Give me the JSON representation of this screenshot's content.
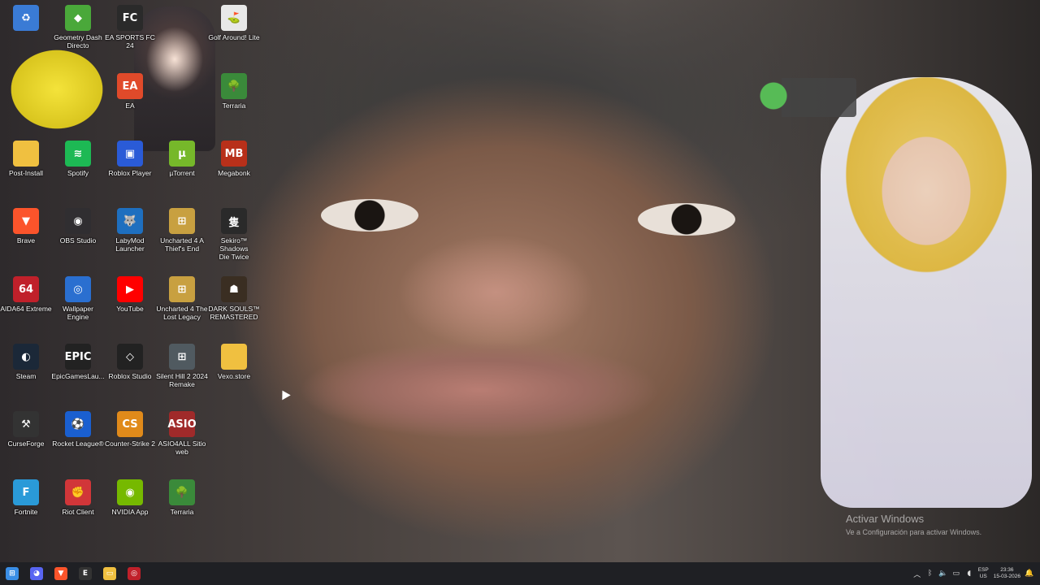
{
  "desktop": {
    "icons": [
      {
        "label": "",
        "icon": "recycle-bin-icon",
        "color": "#3a7bd5",
        "glyph": "♻"
      },
      {
        "label": "Geometry Dash\nDirecto",
        "icon": "geometry-dash-icon",
        "color": "#4aa83a",
        "glyph": "◆"
      },
      {
        "label": "EA SPORTS FC\n24",
        "icon": "ea-sports-fc-icon",
        "color": "#2a2a2a",
        "glyph": "FC"
      },
      {
        "label": "Golf Around! Lite",
        "icon": "golf-around-icon",
        "color": "#e8e8e8",
        "glyph": "⛳"
      },
      {
        "label": "EA",
        "icon": "ea-app-icon",
        "color": "#e04a2a",
        "glyph": "EA"
      },
      {
        "label": "Terraria",
        "icon": "terraria-icon",
        "color": "#3a8a3a",
        "glyph": "🌳"
      },
      {
        "label": "Post-Install",
        "icon": "folder-icon",
        "color": "#f0c040",
        "glyph": ""
      },
      {
        "label": "Spotify",
        "icon": "spotify-icon",
        "color": "#1db954",
        "glyph": "≋"
      },
      {
        "label": "Roblox Player",
        "icon": "roblox-player-icon",
        "color": "#2a5bd7",
        "glyph": "▣"
      },
      {
        "label": "µTorrent",
        "icon": "utorrent-icon",
        "color": "#76b82a",
        "glyph": "µ"
      },
      {
        "label": "Megabonk",
        "icon": "megabonk-icon",
        "color": "#b8301a",
        "glyph": "MB"
      },
      {
        "label": "Brave",
        "icon": "brave-icon",
        "color": "#fb542b",
        "glyph": "▼"
      },
      {
        "label": "OBS Studio",
        "icon": "obs-studio-icon",
        "color": "#302e31",
        "glyph": "◉"
      },
      {
        "label": "LabyMod\nLauncher",
        "icon": "labymod-icon",
        "color": "#1e6fbf",
        "glyph": "🐺"
      },
      {
        "label": "Uncharted 4 A\nThief's End",
        "icon": "uncharted-4-icon",
        "color": "#c8a040",
        "glyph": "⊞"
      },
      {
        "label": "Sekiro™ Shadows\nDie Twice",
        "icon": "sekiro-icon",
        "color": "#2a2a2a",
        "glyph": "隻"
      },
      {
        "label": "AIDA64 Extreme",
        "icon": "aida64-icon",
        "color": "#c0202a",
        "glyph": "64"
      },
      {
        "label": "Wallpaper Engine",
        "icon": "wallpaper-engine-icon",
        "color": "#2a6fd0",
        "glyph": "◎"
      },
      {
        "label": "YouTube",
        "icon": "youtube-icon",
        "color": "#ff0000",
        "glyph": "▶"
      },
      {
        "label": "Uncharted 4 The\nLost Legacy",
        "icon": "uncharted-lost-legacy-icon",
        "color": "#c8a040",
        "glyph": "⊞"
      },
      {
        "label": "DARK SOULS™\nREMASTERED",
        "icon": "dark-souls-icon",
        "color": "#3a2e22",
        "glyph": "☗"
      },
      {
        "label": "Steam",
        "icon": "steam-icon",
        "color": "#1b2838",
        "glyph": "◐"
      },
      {
        "label": "EpicGamesLau...",
        "icon": "epic-games-icon",
        "color": "#222",
        "glyph": "EPIC"
      },
      {
        "label": "Roblox Studio",
        "icon": "roblox-studio-icon",
        "color": "#222",
        "glyph": "◇"
      },
      {
        "label": "Silent Hill 2 2024\nRemake",
        "icon": "silent-hill-icon",
        "color": "#505a60",
        "glyph": "⊞"
      },
      {
        "label": "Vexo.store",
        "icon": "folder-icon",
        "color": "#f0c040",
        "glyph": ""
      },
      {
        "label": "CurseForge",
        "icon": "curseforge-icon",
        "color": "#333",
        "glyph": "⚒"
      },
      {
        "label": "Rocket League®",
        "icon": "rocket-league-icon",
        "color": "#1a5fd0",
        "glyph": "⚽"
      },
      {
        "label": "Counter-Strike 2",
        "icon": "counter-strike-icon",
        "color": "#e08a1a",
        "glyph": "CS"
      },
      {
        "label": "ASIO4ALL Sitio\nweb",
        "icon": "asio4all-icon",
        "color": "#a02a2a",
        "glyph": "ASIO"
      },
      {
        "label": "Fortnite",
        "icon": "fortnite-icon",
        "color": "#2a9ad8",
        "glyph": "F"
      },
      {
        "label": "Riot Client",
        "icon": "riot-client-icon",
        "color": "#d13639",
        "glyph": "✊"
      },
      {
        "label": "NVIDIA App",
        "icon": "nvidia-app-icon",
        "color": "#76b900",
        "glyph": "◉"
      },
      {
        "label": "Terraria",
        "icon": "terraria-icon",
        "color": "#3a8a3a",
        "glyph": "🌳"
      }
    ]
  },
  "activation": {
    "title": "Activar Windows",
    "subtitle": "Ve a Configuración para activar Windows."
  },
  "taskbar": {
    "apps": [
      {
        "icon": "windows-start-icon",
        "color": "#3a8ee6",
        "glyph": "⊞"
      },
      {
        "icon": "discord-icon",
        "color": "#5865f2",
        "glyph": "◕"
      },
      {
        "icon": "brave-icon",
        "color": "#fb542b",
        "glyph": "▼"
      },
      {
        "icon": "epic-games-icon",
        "color": "#333",
        "glyph": "E"
      },
      {
        "icon": "file-explorer-icon",
        "color": "#f0c040",
        "glyph": "▭"
      },
      {
        "icon": "app-icon",
        "color": "#c0202a",
        "glyph": "◎"
      }
    ],
    "tray": {
      "lang": "ESP",
      "region": "US",
      "time": "23:36",
      "date": "15-03-2026"
    }
  }
}
